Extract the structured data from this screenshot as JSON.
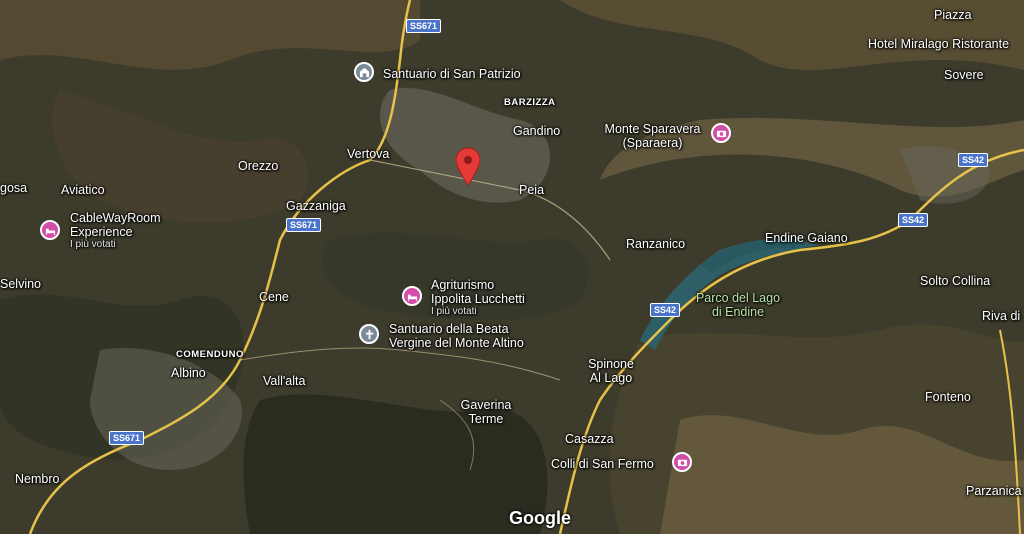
{
  "map": {
    "places": {
      "piazza": "Piazza",
      "hotel": "Hotel Miralago Ristorante",
      "sovere": "Sovere",
      "santuario_patrizio": "Santuario di San Patrizio",
      "barzizza": "BARZIZZA",
      "gandino": "Gandino",
      "monte_sparavera_1": "Monte Sparavera",
      "monte_sparavera_2": "(Sparaera)",
      "vertova": "Vertova",
      "orezzo": "Orezzo",
      "aviatico": "Aviatico",
      "gosa": "gosa",
      "cableway_1": "CableWayRoom",
      "cableway_2": "Experience",
      "cableway_sub": "I più votati",
      "gazzaniga": "Gazzaniga",
      "peia": "Peia",
      "ranzanico": "Ranzanico",
      "endine_gaiano": "Endine Gaiano",
      "solto_collina": "Solto Collina",
      "selvino": "Selvino",
      "cene": "Cene",
      "agriturismo_1": "Agriturismo",
      "agriturismo_2": "Ippolita Lucchetti",
      "agriturismo_sub": "I più votati",
      "parco_1": "Parco del Lago",
      "parco_2": "di Endine",
      "riva": "Riva di",
      "santuario_beata_1": "Santuario della Beata",
      "santuario_beata_2": "Vergine del Monte Altino",
      "comenduno": "COMENDUNO",
      "albino": "Albino",
      "vallalta": "Vall'alta",
      "spinone_1": "Spinone",
      "spinone_2": "Al Lago",
      "fonteno": "Fonteno",
      "gaverina_1": "Gaverina",
      "gaverina_2": "Terme",
      "casazza": "Casazza",
      "colli": "Colli di San Fermo",
      "nembro": "Nembro",
      "parzanica": "Parzanica"
    },
    "shields": {
      "ss671_top": "SS671",
      "ss671_mid": "SS671",
      "ss671_bottom": "SS671",
      "ss42_a": "SS42",
      "ss42_b": "SS42",
      "ss42_c": "SS42"
    },
    "logo": "Google",
    "colors": {
      "poi_pink": "#d14da8",
      "poi_gray": "#7a8a99",
      "pin_red": "#e53935",
      "road_yellow": "#e7c24a",
      "lake": "#2f5f66",
      "shield_blue": "#4a74c9"
    }
  }
}
